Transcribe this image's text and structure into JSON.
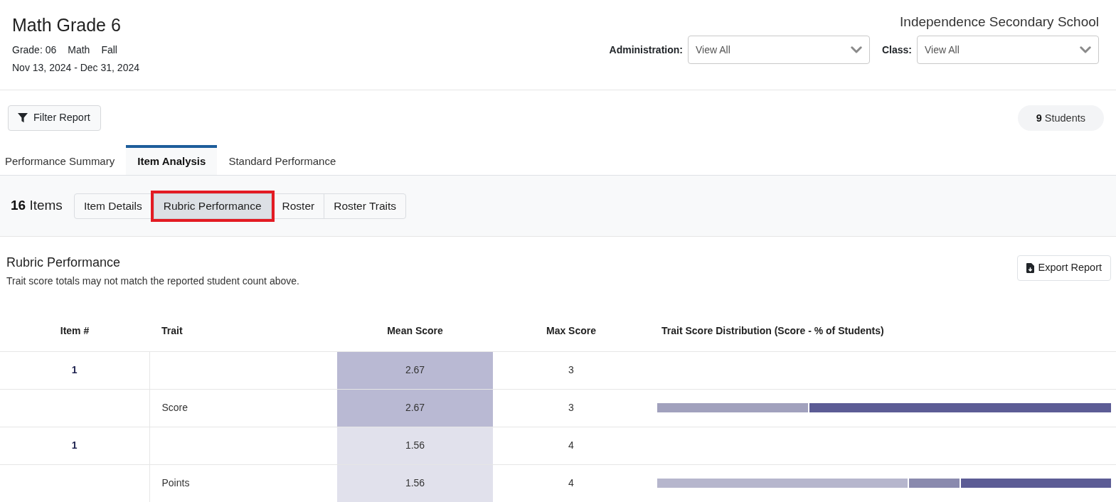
{
  "header": {
    "title": "Math Grade 6",
    "meta": [
      "Grade: 06",
      "Math",
      "Fall"
    ],
    "date_range": "Nov 13, 2024 - Dec 31, 2024",
    "school": "Independence Secondary School",
    "filters": [
      {
        "label": "Administration:",
        "value": "View All"
      },
      {
        "label": "Class:",
        "value": "View All"
      }
    ]
  },
  "toolbar": {
    "filter_button": "Filter Report",
    "student_count": "**9** Students"
  },
  "tabs": [
    {
      "label": "Performance Summary",
      "selected": false
    },
    {
      "label": "Item Analysis",
      "selected": true
    },
    {
      "label": "Standard Performance",
      "selected": false
    }
  ],
  "subbar": {
    "item_count": "**16** Items",
    "views": [
      {
        "label": "Item Details",
        "selected": false,
        "highlighted": false
      },
      {
        "label": "Rubric Performance",
        "selected": true,
        "highlighted": true
      },
      {
        "label": "Roster",
        "selected": false,
        "highlighted": false
      },
      {
        "label": "Roster Traits",
        "selected": false,
        "highlighted": false
      }
    ]
  },
  "section": {
    "title": "Rubric Performance",
    "note": "Trait score totals may not match the reported student count above.",
    "export_button": "Export Report"
  },
  "table": {
    "columns": [
      "Item #",
      "Trait",
      "Mean Score",
      "Max Score",
      "Trait Score Distribution (Score - % of Students)"
    ],
    "rows": [
      {
        "kind": "item",
        "item": "1",
        "mean": "2.67",
        "max": "3",
        "color": "#b9b9d3"
      },
      {
        "kind": "trait",
        "trait": "Score",
        "mean": "2.67",
        "max": "3",
        "color": "#b9b9d3",
        "segments": [
          {
            "color": "#a1a1bd"
          },
          {
            "color": "#5c5c95"
          }
        ]
      },
      {
        "kind": "item",
        "item": "1",
        "mean": "1.56",
        "max": "4",
        "color": "#e1e1ec"
      },
      {
        "kind": "trait",
        "trait": "Points",
        "mean": "1.56",
        "max": "4",
        "color": "#e1e1ec",
        "segments": [
          {
            "color": "#b6b6cd"
          },
          {
            "color": "#8a8aae"
          },
          {
            "color": "#5c5c95"
          }
        ]
      }
    ]
  }
}
